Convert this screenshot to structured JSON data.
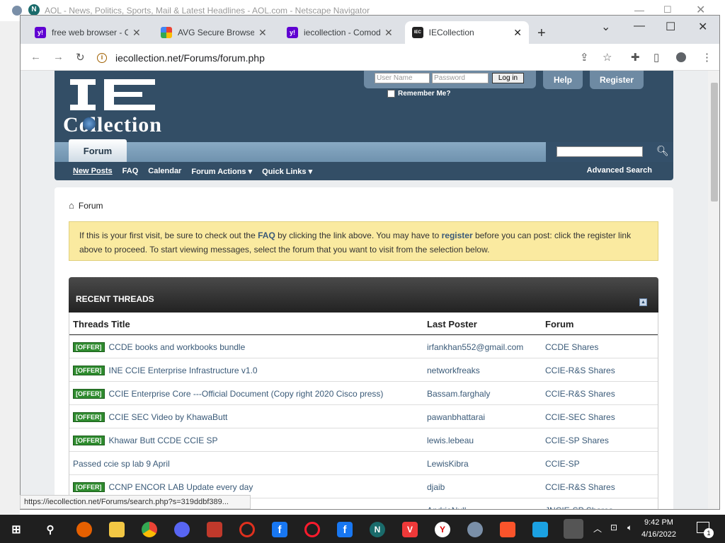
{
  "background_window": {
    "title": "AOL - News, Politics, Sports, Mail & Latest Headlines - AOL.com - Netscape Navigator"
  },
  "browser": {
    "tabs": [
      {
        "label": "free web browser - C",
        "icon": "yahoo-icon",
        "color": "#6001d2",
        "letter": "y!"
      },
      {
        "label": "AVG Secure Browser",
        "icon": "google-icon",
        "color": "#ffffff",
        "letter": "G"
      },
      {
        "label": "iecollection - Comod",
        "icon": "yahoo-icon",
        "color": "#6001d2",
        "letter": "y!"
      },
      {
        "label": "IECollection",
        "icon": "iec-icon",
        "color": "#222222",
        "letter": "IEC"
      }
    ],
    "url": "iecollection.net/Forums/forum.php",
    "status_url": "https://iecollection.net/Forums/search.php?s=319ddbf389..."
  },
  "forum": {
    "logo_top": "IE",
    "logo_bottom": "Collection",
    "login": {
      "username_placeholder": "User Name",
      "password_placeholder": "Password",
      "button": "Log in",
      "remember": "Remember Me?"
    },
    "help": "Help",
    "register": "Register",
    "nav_tab": "Forum",
    "subnav": [
      "New Posts",
      "FAQ",
      "Calendar",
      "Forum Actions",
      "Quick Links"
    ],
    "advanced_search": "Advanced Search",
    "breadcrumb": "Forum",
    "notice": {
      "p1": "If this is your first visit, be sure to check out the ",
      "faq": "FAQ",
      "p2": " by clicking the link above. You may have to ",
      "register": "register",
      "p3": " before you can post: click the register link above to proceed. To start viewing messages, select the forum that you want to visit from the selection below."
    },
    "recent_threads": {
      "title": "RECENT THREADS",
      "headers": [
        "Threads Title",
        "Last Poster",
        "Forum"
      ],
      "rows": [
        {
          "badge": "[OFFER]",
          "title": "CCDE books and workbooks bundle",
          "poster": "irfankhan552@gmail.com",
          "forum": "CCDE Shares"
        },
        {
          "badge": "[OFFER]",
          "title": "INE CCIE Enterprise Infrastructure v1.0",
          "poster": "networkfreaks",
          "forum": "CCIE-R&S Shares"
        },
        {
          "badge": "[OFFER]",
          "title": "CCIE Enterprise Core ---Official Document (Copy right 2020 Cisco press)",
          "poster": "Bassam.farghaly",
          "forum": "CCIE-R&S Shares"
        },
        {
          "badge": "[OFFER]",
          "title": "CCIE SEC Video by KhawaButt",
          "poster": "pawanbhattarai",
          "forum": "CCIE-SEC Shares"
        },
        {
          "badge": "[OFFER]",
          "title": "Khawar Butt CCDE CCIE SP",
          "poster": "lewis.lebeau",
          "forum": "CCIE-SP Shares"
        },
        {
          "badge": "",
          "title": "Passed ccie sp lab 9 April",
          "poster": "LewisKibra",
          "forum": "CCIE-SP"
        },
        {
          "badge": "[OFFER]",
          "title": "CCNP ENCOR LAB Update every day",
          "poster": "djaib",
          "forum": "CCIE-R&S Shares"
        },
        {
          "badge": "",
          "title": "",
          "poster": "AndriaNull",
          "forum": "JNCIE-SP Shares"
        }
      ]
    }
  },
  "taskbar": {
    "time": "9:42 PM",
    "date": "4/16/2022",
    "notification_count": "1"
  }
}
